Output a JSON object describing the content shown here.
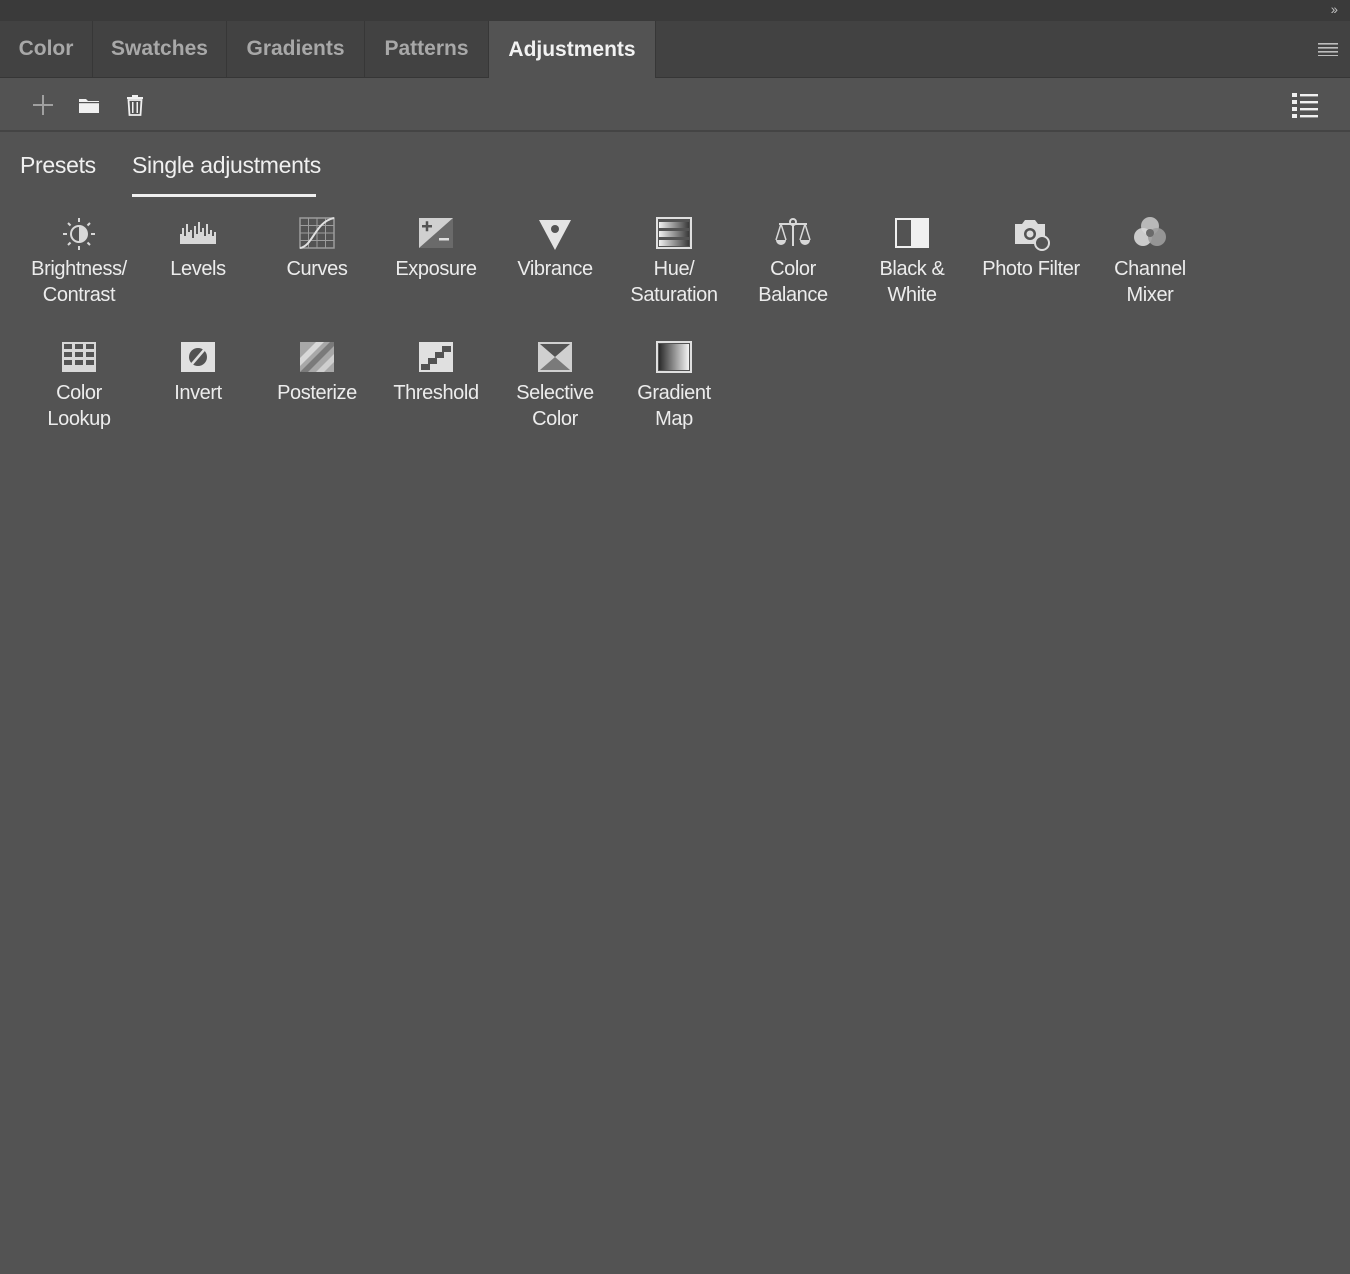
{
  "window": {
    "collapse_label": "››"
  },
  "tabs": [
    {
      "label": "Color"
    },
    {
      "label": "Swatches"
    },
    {
      "label": "Gradients"
    },
    {
      "label": "Patterns"
    },
    {
      "label": "Adjustments"
    }
  ],
  "active_tab": "Adjustments",
  "toolbar": {
    "icons": [
      "plus-icon",
      "folder-icon",
      "trash-icon",
      "list-view-icon"
    ]
  },
  "subtabs": {
    "presets": "Presets",
    "single": "Single adjustments",
    "active": "Single adjustments"
  },
  "adjustments": [
    {
      "label": "Brightness/\nContrast",
      "icon": "brightness-contrast-icon"
    },
    {
      "label": "Levels",
      "icon": "levels-icon"
    },
    {
      "label": "Curves",
      "icon": "curves-icon"
    },
    {
      "label": "Exposure",
      "icon": "exposure-icon"
    },
    {
      "label": "Vibrance",
      "icon": "vibrance-icon"
    },
    {
      "label": "Hue/\nSaturation",
      "icon": "hue-saturation-icon"
    },
    {
      "label": "Color\nBalance",
      "icon": "color-balance-icon"
    },
    {
      "label": "Black &\nWhite",
      "icon": "black-white-icon"
    },
    {
      "label": "Photo Filter",
      "icon": "photo-filter-icon"
    },
    {
      "label": "Channel\nMixer",
      "icon": "channel-mixer-icon"
    },
    {
      "label": "Color\nLookup",
      "icon": "color-lookup-icon"
    },
    {
      "label": "Invert",
      "icon": "invert-icon"
    },
    {
      "label": "Posterize",
      "icon": "posterize-icon"
    },
    {
      "label": "Threshold",
      "icon": "threshold-icon"
    },
    {
      "label": "Selective\nColor",
      "icon": "selective-color-icon"
    },
    {
      "label": "Gradient\nMap",
      "icon": "gradient-map-icon"
    }
  ],
  "colors": {
    "panel_bg": "#535353",
    "tabbar_bg": "#424242",
    "text": "#ececec"
  }
}
